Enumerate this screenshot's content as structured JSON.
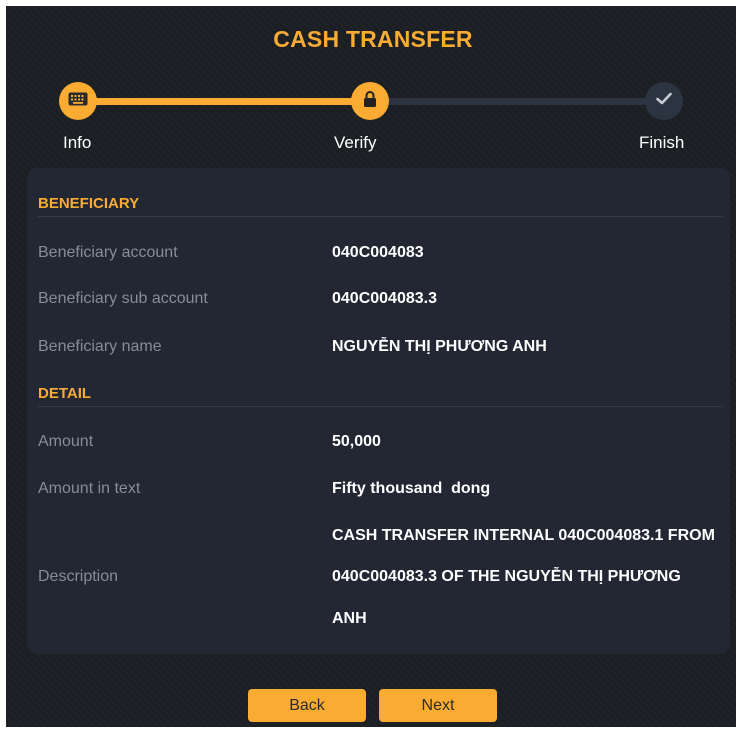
{
  "title": "CASH TRANSFER",
  "steps": [
    {
      "label": "Info",
      "icon": "keyboard-icon",
      "state": "done"
    },
    {
      "label": "Verify",
      "icon": "lock-icon",
      "state": "active"
    },
    {
      "label": "Finish",
      "icon": "check-icon",
      "state": "pending"
    }
  ],
  "beneficiary": {
    "heading": "BENEFICIARY",
    "account_label": "Beneficiary account",
    "account_value": "040C004083",
    "sub_account_label": "Beneficiary sub account",
    "sub_account_value": "040C004083.3",
    "name_label": "Beneficiary name",
    "name_value": "NGUYỄN THỊ PHƯƠNG ANH"
  },
  "detail": {
    "heading": "DETAIL",
    "amount_label": "Amount",
    "amount_value": "50,000",
    "amount_text_label": "Amount in text",
    "amount_text_value": "Fifty thousand  dong",
    "description_label": "Description",
    "description_lines": [
      "CASH TRANSFER INTERNAL 040C004083.1 FROM",
      "040C004083.3 OF THE NGUYỄN THỊ PHƯƠNG",
      "ANH"
    ]
  },
  "buttons": {
    "back": "Back",
    "next": "Next"
  },
  "colors": {
    "accent": "#f9ab32",
    "background": "#1b1e23",
    "card": "#222733",
    "pending": "#2c3442"
  }
}
